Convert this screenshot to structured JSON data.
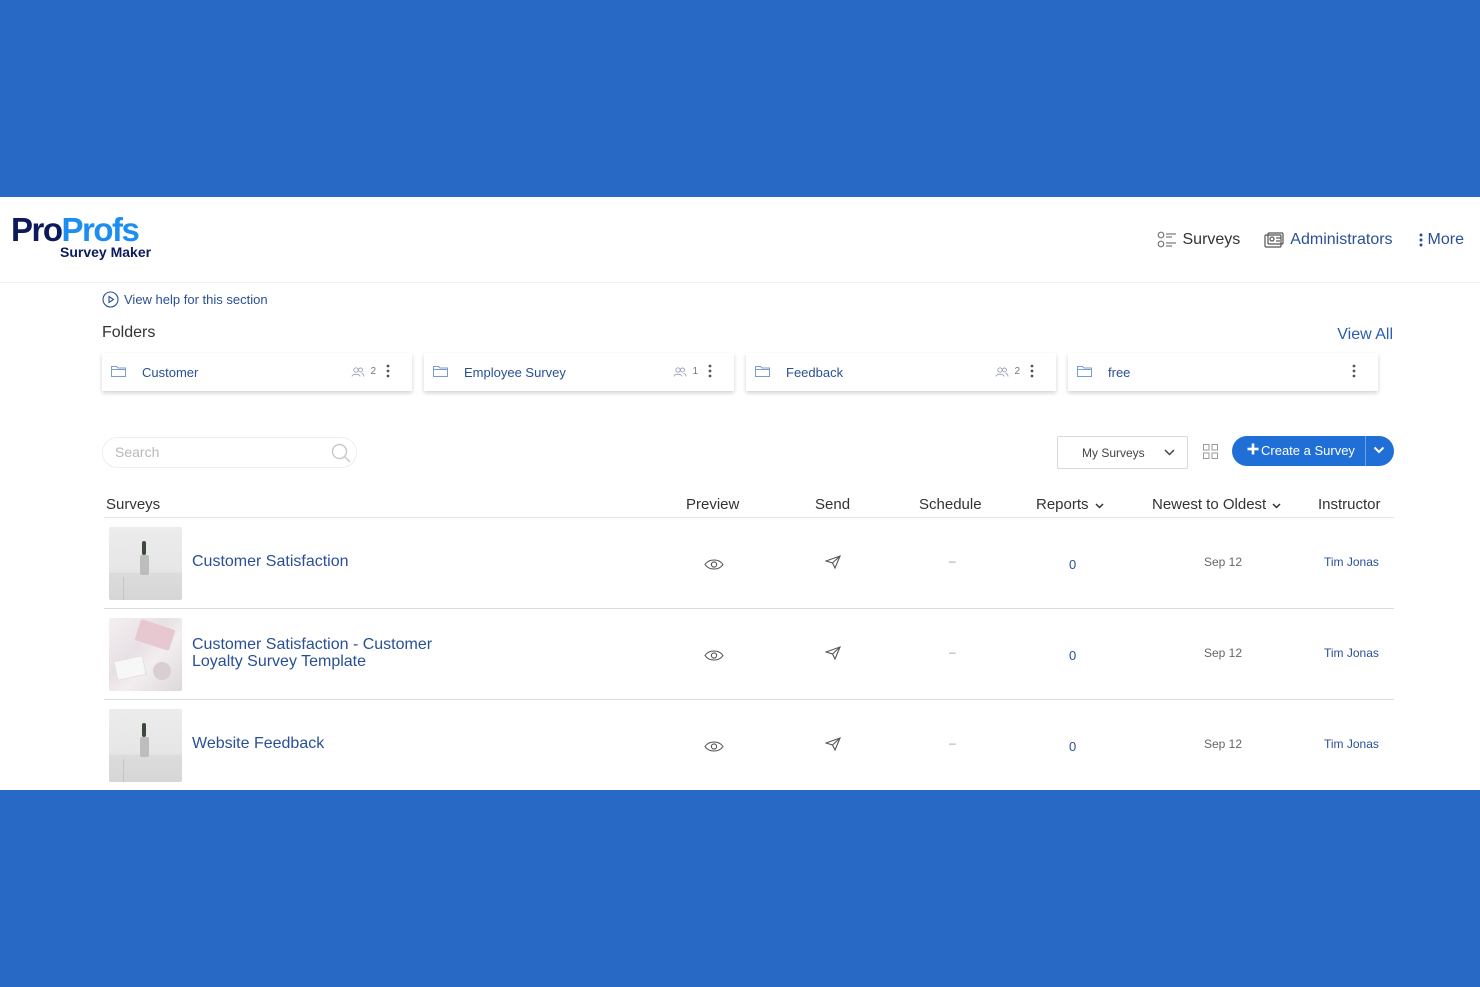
{
  "brand": {
    "logo_part1": "Pro",
    "logo_part2": "Profs",
    "product": "Survey Maker"
  },
  "nav": {
    "surveys": "Surveys",
    "administrators": "Administrators",
    "more": "More"
  },
  "help_link": "View help for this section",
  "folders": {
    "title": "Folders",
    "view_all": "View All",
    "items": [
      {
        "name": "Customer",
        "users": "2"
      },
      {
        "name": "Employee Survey",
        "users": "1"
      },
      {
        "name": "Feedback",
        "users": "2"
      },
      {
        "name": "free",
        "users": ""
      }
    ]
  },
  "toolbar": {
    "search_placeholder": "Search",
    "filter_value": "My Surveys",
    "create_label": "Create a Survey"
  },
  "table": {
    "headers": {
      "surveys": "Surveys",
      "preview": "Preview",
      "send": "Send",
      "schedule": "Schedule",
      "reports": "Reports",
      "sort": "Newest to Oldest",
      "instructor": "Instructor"
    },
    "rows": [
      {
        "title": "Customer Satisfaction",
        "schedule": "–",
        "reports": "0",
        "date": "Sep 12",
        "instructor": "Tim Jonas"
      },
      {
        "title": "Customer Satisfaction - Customer Loyalty Survey Template",
        "schedule": "–",
        "reports": "0",
        "date": "Sep 12",
        "instructor": "Tim Jonas"
      },
      {
        "title": "Website Feedback",
        "schedule": "–",
        "reports": "0",
        "date": "Sep 12",
        "instructor": "Tim Jonas"
      }
    ]
  },
  "colors": {
    "background": "#2769c4",
    "accent": "#1f6fd6",
    "link": "#2a4f97",
    "brand_dark": "#0c1a5c",
    "brand_light": "#1b8ef0"
  }
}
